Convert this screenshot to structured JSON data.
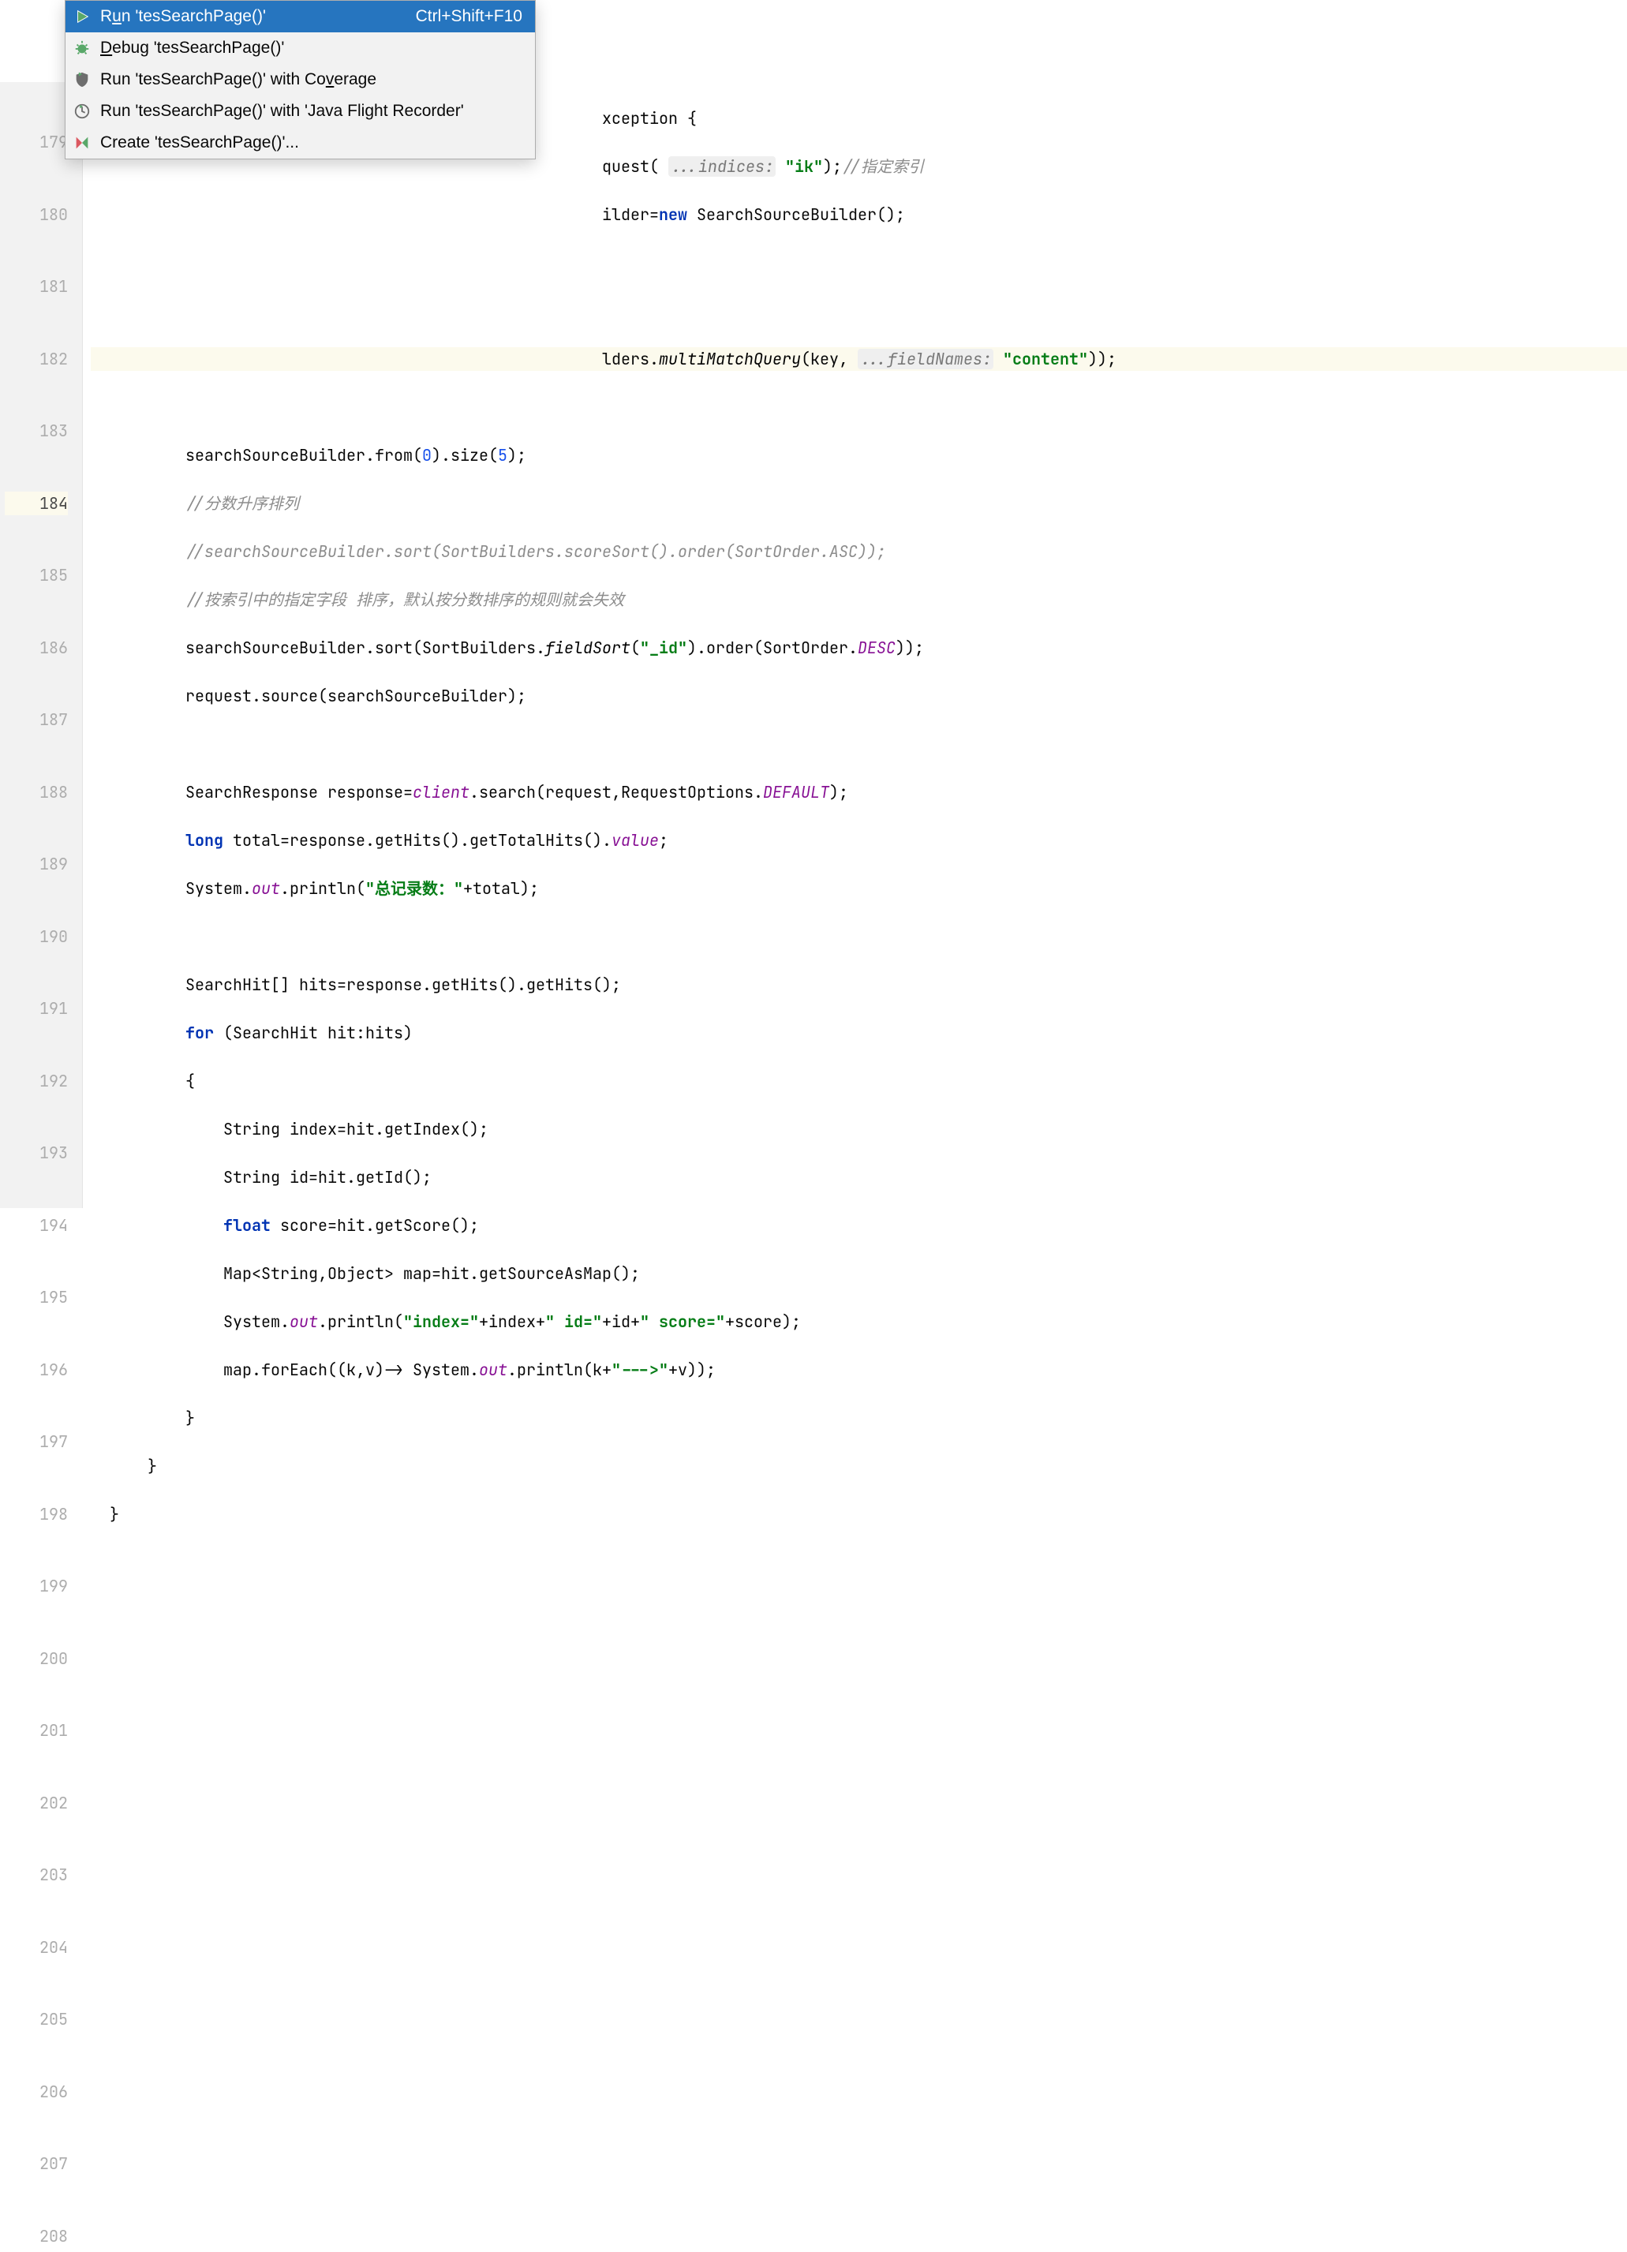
{
  "gutter": {
    "start": 179,
    "end": 208,
    "active": 184
  },
  "menu": {
    "items": [
      {
        "label_pre": "R",
        "mnem": "u",
        "label_post": "n 'tesSearchPage()'",
        "shortcut": "Ctrl+Shift+F10",
        "icon": "run-icon"
      },
      {
        "label_pre": "",
        "mnem": "D",
        "label_post": "ebug 'tesSearchPage()'",
        "shortcut": "",
        "icon": "debug-icon"
      },
      {
        "label_pre": "Run 'tesSearchPage()' with Co",
        "mnem": "v",
        "label_post": "erage",
        "shortcut": "",
        "icon": "coverage-icon"
      },
      {
        "label_pre": "",
        "mnem": "",
        "label_post": "Run 'tesSearchPage()' with 'Java Flight Recorder'",
        "shortcut": "",
        "icon": "jfr-icon"
      },
      {
        "label_pre": "",
        "mnem": "",
        "label_post": "Create 'tesSearchPage()'...",
        "shortcut": "",
        "icon": "create-icon"
      }
    ]
  },
  "code": {
    "l179": {
      "tail": "xception {"
    },
    "l180": {
      "a": "quest( ",
      "hint": "...indices:",
      "b": " ",
      "s": "\"ik\"",
      "c": ");",
      "cmt": "//指定索引"
    },
    "l181": {
      "a": "ilder=",
      "kw": "new",
      "b": " SearchSourceBuilder();"
    },
    "l184": {
      "a": "lders.",
      "m": "multiMatchQuery",
      "b": "(key, ",
      "hint": "...fieldNames:",
      "c": " ",
      "s": "\"content\"",
      "d": "));"
    },
    "l186": {
      "a": "searchSourceBuilder.from(",
      "n0": "0",
      "b": ").size(",
      "n1": "5",
      "c": ");"
    },
    "l187": {
      "cmt": "//分数升序排列"
    },
    "l188": {
      "cmt": "//searchSourceBuilder.sort(SortBuilders.scoreSort().order(SortOrder.ASC));"
    },
    "l189": {
      "cmt": "//按索引中的指定字段 排序，默认按分数排序的规则就会失效"
    },
    "l190": {
      "a": "searchSourceBuilder.sort(SortBuilders.",
      "m": "fieldSort",
      "b": "(",
      "s": "\"_id\"",
      "c": ").order(SortOrder.",
      "k": "DESC",
      "d": "));"
    },
    "l191": {
      "a": "request.source(searchSourceBuilder);"
    },
    "l193": {
      "a": "SearchResponse response=",
      "f": "client",
      "b": ".search(request,RequestOptions.",
      "k": "DEFAULT",
      "c": ");"
    },
    "l194": {
      "kw": "long",
      "a": " total=response.getHits().getTotalHits().",
      "f": "value",
      "b": ";"
    },
    "l195": {
      "a": "System.",
      "f": "out",
      "b": ".println(",
      "s": "\"总记录数：\"",
      "c": "+total);"
    },
    "l197": {
      "a": "SearchHit[] hits=response.getHits().getHits();"
    },
    "l198": {
      "kw": "for",
      "a": " (SearchHit hit:hits)"
    },
    "l199": {
      "a": "{"
    },
    "l200": {
      "a": "String index=hit.getIndex();"
    },
    "l201": {
      "a": "String id=hit.getId();"
    },
    "l202": {
      "kw": "float",
      "a": " score=hit.getScore();"
    },
    "l203": {
      "a": "Map<String,Object> map=hit.getSourceAsMap();"
    },
    "l204": {
      "a": "System.",
      "f": "out",
      "b": ".println(",
      "s1": "\"index=\"",
      "c": "+index+",
      "s2": "\" id=\"",
      "d": "+id+",
      "s3": "\" score=\"",
      "e": "+score);"
    },
    "l205": {
      "a": "map.forEach((k,v)-> System.",
      "f": "out",
      "b": ".println(k+",
      "s": "\"--->\"",
      "c": "+v));"
    },
    "l206": {
      "a": "}"
    },
    "l207": {
      "a": "}"
    },
    "l208": {
      "a": "}"
    }
  }
}
